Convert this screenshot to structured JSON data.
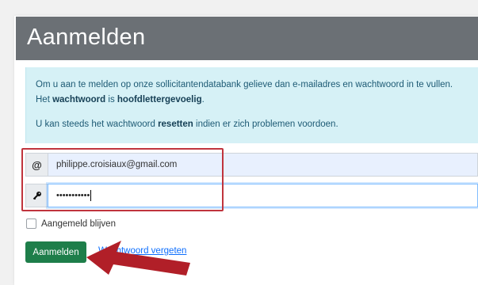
{
  "header": {
    "title": "Aanmelden"
  },
  "info": {
    "line1": "Om u aan te melden op onze sollicitantendatabank gelieve dan e-mailadres en wachtwoord in te vullen.",
    "line2_prefix": "Het ",
    "line2_b1": "wachtwoord",
    "line2_mid": " is ",
    "line2_b2": "hoofdlettergevoelig",
    "line2_suffix": ".",
    "line3_prefix": "U kan steeds het wachtwoord ",
    "line3_bold": "resetten",
    "line3_suffix": " indien er zich problemen voordoen."
  },
  "email": {
    "icon": "@",
    "value": "philippe.croisiaux@gmail.com"
  },
  "password": {
    "icon_name": "key-icon",
    "masked_value": "•••••••••••"
  },
  "remember": {
    "label": "Aangemeld blijven",
    "checked": false
  },
  "actions": {
    "login_label": "Aanmelden",
    "forgot_label": "Wachtwoord vergeten"
  },
  "colors": {
    "header": "#6b7075",
    "alert_bg": "#d6f1f6",
    "button": "#1e7e4a",
    "annotation": "#c0343d"
  }
}
